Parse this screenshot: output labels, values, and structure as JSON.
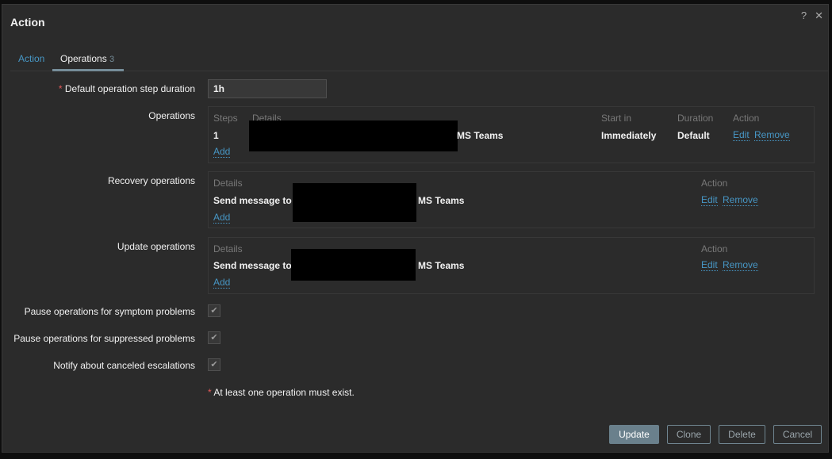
{
  "title": "Action",
  "icons": {
    "help": "?",
    "close": "✕"
  },
  "tabs": [
    {
      "label": "Action"
    },
    {
      "label": "Operations",
      "count": "3"
    }
  ],
  "default_step": {
    "label": "Default operation step duration",
    "value": "1h"
  },
  "operations": {
    "label": "Operations",
    "headers": [
      "Steps",
      "Details",
      "Start in",
      "Duration",
      "Action"
    ],
    "rows": [
      {
        "steps": "1",
        "details_suffix": "MS Teams",
        "start_in": "Immediately",
        "duration": "Default",
        "edit": "Edit",
        "remove": "Remove"
      }
    ],
    "add": "Add"
  },
  "recovery": {
    "label": "Recovery operations",
    "headers": [
      "Details",
      "Action"
    ],
    "rows": [
      {
        "details": "Send message to",
        "details_suffix": "MS Teams",
        "edit": "Edit",
        "remove": "Remove"
      }
    ],
    "add": "Add"
  },
  "update": {
    "label": "Update operations",
    "headers": [
      "Details",
      "Action"
    ],
    "rows": [
      {
        "details": "Send message to",
        "details_suffix": "MS Teams",
        "edit": "Edit",
        "remove": "Remove"
      }
    ],
    "add": "Add"
  },
  "checkboxes": [
    {
      "label": "Pause operations for symptom problems",
      "checked": true
    },
    {
      "label": "Pause operations for suppressed problems",
      "checked": true
    },
    {
      "label": "Notify about canceled escalations",
      "checked": true
    }
  ],
  "warning": "At least one operation must exist.",
  "buttons": {
    "update": "Update",
    "clone": "Clone",
    "delete": "Delete",
    "cancel": "Cancel"
  }
}
